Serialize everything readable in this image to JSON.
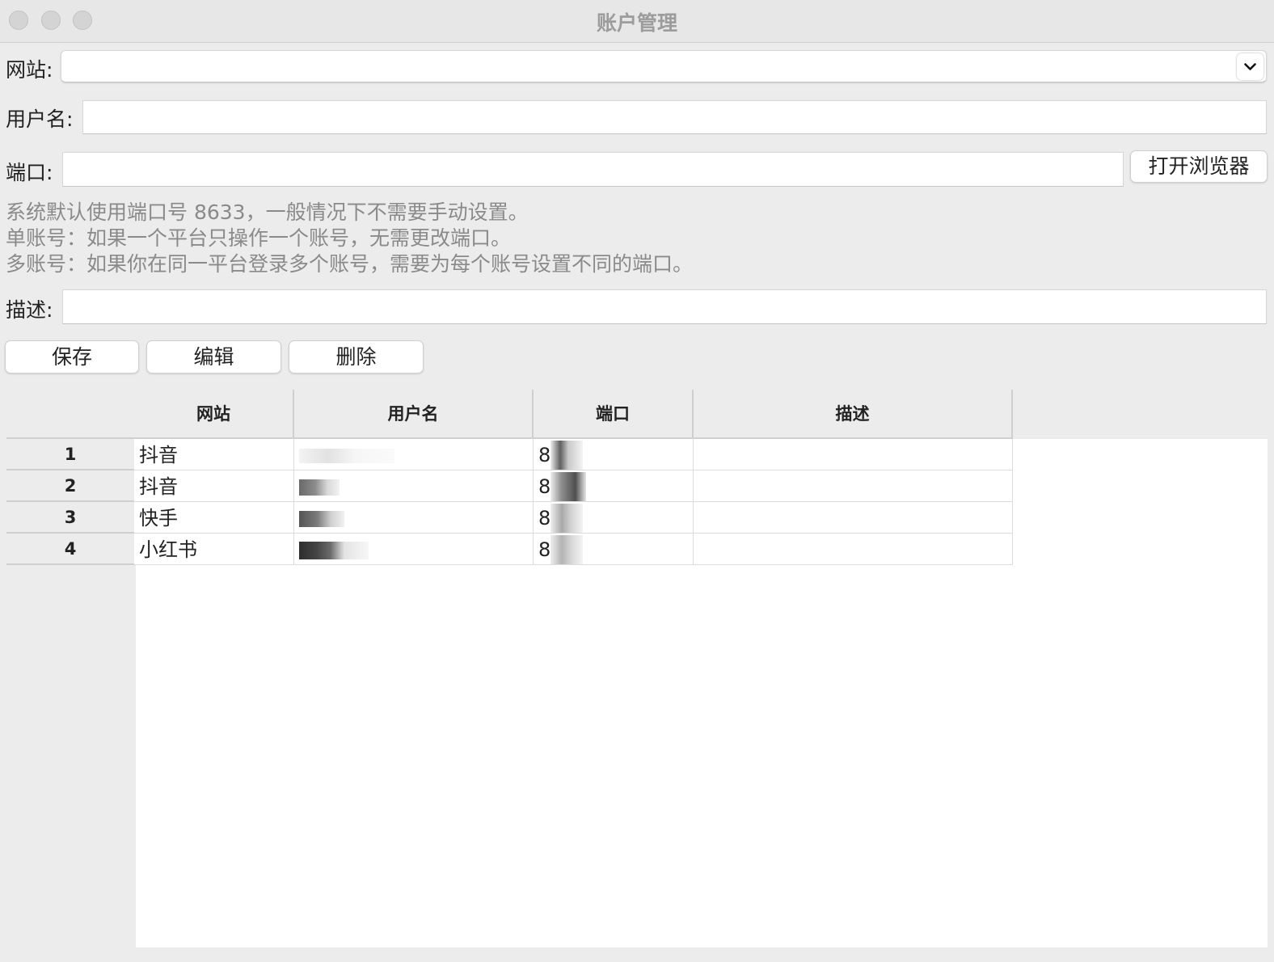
{
  "window": {
    "title": "账户管理"
  },
  "form": {
    "website_label": "网站:",
    "website_value": "",
    "username_label": "用户名:",
    "username_value": "",
    "port_label": "端口:",
    "port_value": "",
    "open_browser_label": "打开浏览器",
    "hints": [
      "系统默认使用端口号 8633，一般情况下不需要手动设置。",
      "单账号：如果一个平台只操作一个账号，无需更改端口。",
      "多账号：如果你在同一平台登录多个账号，需要为每个账号设置不同的端口。"
    ],
    "description_label": "描述:",
    "description_value": ""
  },
  "actions": {
    "save_label": "保存",
    "edit_label": "编辑",
    "delete_label": "删除"
  },
  "table": {
    "columns": [
      "网站",
      "用户名",
      "端口",
      "描述"
    ],
    "rows": [
      {
        "index": "1",
        "website": "抖音",
        "username": "",
        "port": "8",
        "description": ""
      },
      {
        "index": "2",
        "website": "抖音",
        "username": "",
        "port": "8",
        "description": ""
      },
      {
        "index": "3",
        "website": "快手",
        "username": "",
        "port": "8",
        "description": ""
      },
      {
        "index": "4",
        "website": "小红书",
        "username": "",
        "port": "8",
        "description": ""
      }
    ]
  },
  "icons": {
    "combo_arrow": "chevron-down-icon"
  },
  "colors": {
    "window_bg": "#ececec",
    "title_text": "#9c9c9c",
    "hint_text": "#8a8a8a",
    "table_bg": "#ffffff"
  }
}
